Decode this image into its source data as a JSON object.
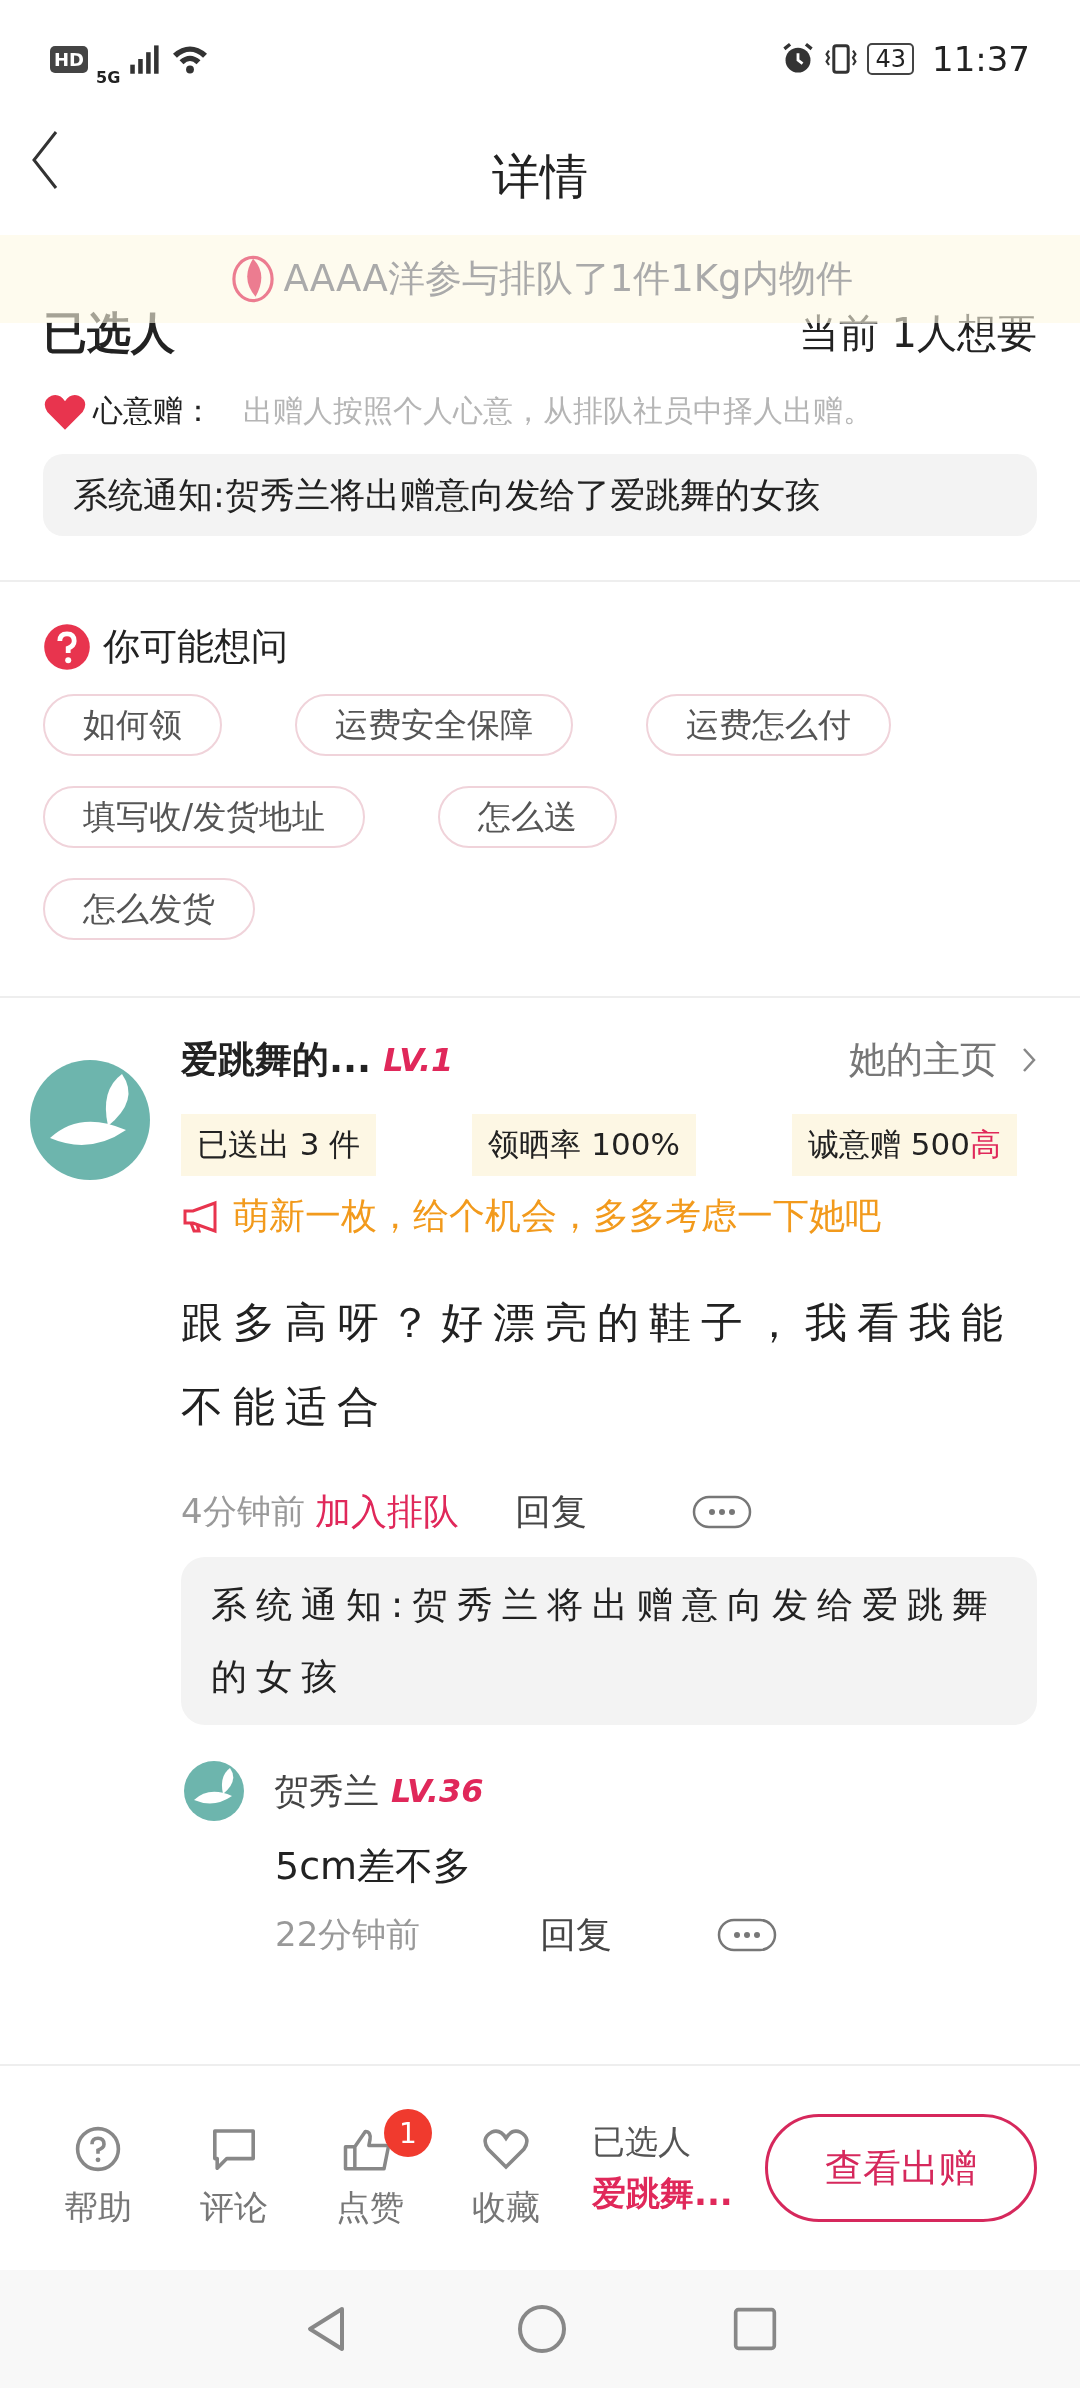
{
  "status_bar": {
    "hd": "HD",
    "network": "5G",
    "battery": "43",
    "time": "11:37"
  },
  "header": {
    "title": "详情"
  },
  "banner": {
    "text": "AAAA洋参与排队了1件1Kg内物件"
  },
  "selection": {
    "title": "已选人",
    "count": "当前 1人想要",
    "mode_label": "心意赠：",
    "mode_desc": "出赠人按照个人心意，从排队社员中择人出赠。",
    "notice": "系统通知:贺秀兰将出赠意向发给了爱跳舞的女孩"
  },
  "faq": {
    "title": "你可能想问",
    "question_rows": [
      [
        "如何领",
        "运费安全保障",
        "运费怎么付"
      ],
      [
        "填写收/发货地址",
        "怎么送"
      ],
      [
        "怎么发货"
      ]
    ]
  },
  "comment": {
    "name": "爱跳舞的...",
    "level": "LV.1",
    "profile_link": "她的主页",
    "stats": [
      {
        "label": "已送出 3 件"
      },
      {
        "label": "领晒率 100%"
      },
      {
        "label": "诚意赠 500",
        "rating": "高"
      }
    ],
    "promo": "萌新一枚，给个机会，多多考虑一下她吧",
    "text": "跟多高呀？好漂亮的鞋子，我看我能不能适合",
    "time": "4分钟前",
    "action": "加入排队",
    "reply": "回复",
    "system_notice": "系统通知:贺秀兰将出赠意向发给爱跳舞的女孩",
    "replies": [
      {
        "name": "贺秀兰",
        "level": "LV.36",
        "text": "5cm差不多",
        "time": "22分钟前",
        "reply": "回复"
      }
    ]
  },
  "bottom_bar": {
    "actions": [
      {
        "kind": "help",
        "label": "帮助"
      },
      {
        "kind": "comment",
        "label": "评论"
      },
      {
        "kind": "like",
        "label": "点赞",
        "badge": "1"
      },
      {
        "kind": "favorite",
        "label": "收藏"
      }
    ],
    "selected_label": "已选人",
    "selected_name": "爱跳舞...",
    "button": "查看出赠"
  }
}
